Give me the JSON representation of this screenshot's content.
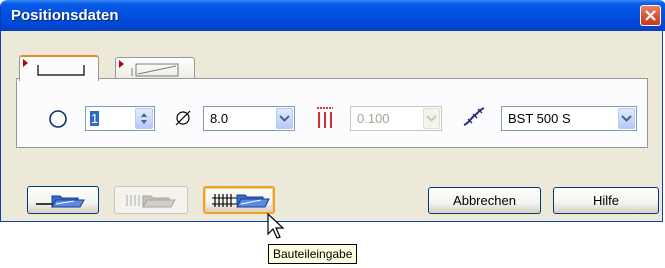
{
  "window": {
    "title": "Positionsdaten",
    "close_icon": "close-icon"
  },
  "tabs": [
    {
      "icon": "bar-shape-icon",
      "active": true
    },
    {
      "icon": "mesh-shape-icon",
      "active": false
    }
  ],
  "fields": {
    "count": {
      "icon": "circle-icon",
      "value": "1"
    },
    "diameter": {
      "icon": "diameter-icon",
      "value": "8.0"
    },
    "spacing": {
      "icon": "spacing-icon",
      "value": "0.100",
      "disabled": true
    },
    "steel": {
      "icon": "steel-grade-icon",
      "value": "BST 500 S"
    }
  },
  "buttons": {
    "cancel_label": "Abbrechen",
    "help_label": "Hilfe"
  },
  "tooltip": {
    "text": "Bauteileingabe"
  },
  "colors": {
    "titlebar": "#0050e0",
    "close": "#d7502d",
    "tab_accent": "#e68b2c",
    "tooltip_bg": "#ffffe1"
  }
}
